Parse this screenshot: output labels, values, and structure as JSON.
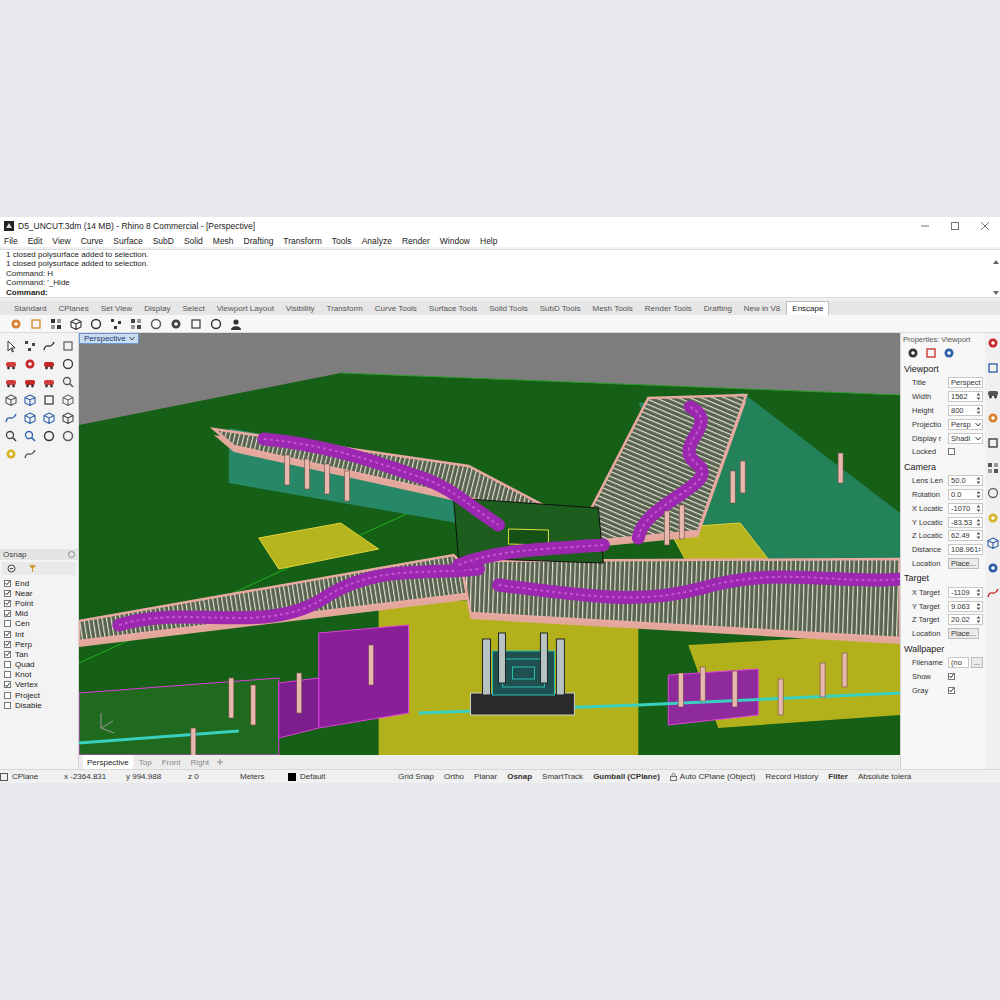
{
  "window": {
    "title": "D5_UNCUT.3dm (14 MB) - Rhino 8 Commercial - [Perspective]"
  },
  "menu": [
    "File",
    "Edit",
    "View",
    "Curve",
    "Surface",
    "SubD",
    "Solid",
    "Mesh",
    "Drafting",
    "Transform",
    "Tools",
    "Analyze",
    "Render",
    "Window",
    "Help"
  ],
  "command": {
    "history": [
      "1 closed polysurface added to selection.",
      "1 closed polysurface added to selection.",
      "Command: H",
      "Command: '_Hide"
    ],
    "prompt": "Command:"
  },
  "toolbar_tabs": [
    {
      "label": "Standard",
      "selected": false
    },
    {
      "label": "CPlanes",
      "selected": false
    },
    {
      "label": "Set View",
      "selected": false
    },
    {
      "label": "Display",
      "selected": false
    },
    {
      "label": "Select",
      "selected": false
    },
    {
      "label": "Viewport Layout",
      "selected": false
    },
    {
      "label": "Visibility",
      "selected": false
    },
    {
      "label": "Transform",
      "selected": false
    },
    {
      "label": "Curve Tools",
      "selected": false
    },
    {
      "label": "Surface Tools",
      "selected": false
    },
    {
      "label": "Solid Tools",
      "selected": false
    },
    {
      "label": "SubD Tools",
      "selected": false
    },
    {
      "label": "Mesh Tools",
      "selected": false
    },
    {
      "label": "Render Tools",
      "selected": false
    },
    {
      "label": "Drafting",
      "selected": false
    },
    {
      "label": "New in V8",
      "selected": false
    },
    {
      "label": "Enscape",
      "selected": true
    }
  ],
  "viewport": {
    "label": "Perspective"
  },
  "viewport_tabs": [
    {
      "label": "Perspective",
      "selected": true
    },
    {
      "label": "Top",
      "selected": false
    },
    {
      "label": "Front",
      "selected": false
    },
    {
      "label": "Right",
      "selected": false
    }
  ],
  "osnap": {
    "title": "Osnap",
    "items": [
      {
        "label": "End",
        "checked": true
      },
      {
        "label": "Near",
        "checked": true
      },
      {
        "label": "Point",
        "checked": true
      },
      {
        "label": "Mid",
        "checked": true
      },
      {
        "label": "Cen",
        "checked": false
      },
      {
        "label": "Int",
        "checked": true
      },
      {
        "label": "Perp",
        "checked": true
      },
      {
        "label": "Tan",
        "checked": true
      },
      {
        "label": "Quad",
        "checked": false
      },
      {
        "label": "Knot",
        "checked": false
      },
      {
        "label": "Vertex",
        "checked": true
      },
      {
        "label": "Project",
        "checked": false
      },
      {
        "label": "Disable",
        "checked": false
      }
    ]
  },
  "properties": {
    "title": "Properties: Viewport",
    "sections": [
      {
        "title": "Viewport",
        "rows": [
          {
            "label": "Title",
            "kind": "text",
            "value": "Perspect"
          },
          {
            "label": "Width",
            "kind": "spin",
            "value": "1562"
          },
          {
            "label": "Height",
            "kind": "spin",
            "value": "800"
          },
          {
            "label": "Projectio",
            "kind": "select",
            "value": "Persp"
          },
          {
            "label": "Display r",
            "kind": "select",
            "value": "Shadi"
          },
          {
            "label": "Locked",
            "kind": "check",
            "checked": false
          }
        ]
      },
      {
        "title": "Camera",
        "rows": [
          {
            "label": "Lens Len",
            "kind": "spin",
            "value": "50.0"
          },
          {
            "label": "Rotation",
            "kind": "spin",
            "value": "0.0"
          },
          {
            "label": "X Locatic",
            "kind": "spin",
            "value": "-1070"
          },
          {
            "label": "Y Locatic",
            "kind": "spin",
            "value": "-83.53"
          },
          {
            "label": "Z Locatic",
            "kind": "spin",
            "value": "62.49"
          },
          {
            "label": "Distance",
            "kind": "spin",
            "value": "108.961"
          },
          {
            "label": "Location",
            "kind": "button",
            "value": "Place..."
          }
        ]
      },
      {
        "title": "Target",
        "rows": [
          {
            "label": "X Target",
            "kind": "spin",
            "value": "-1109"
          },
          {
            "label": "Y Target",
            "kind": "spin",
            "value": "9.063"
          },
          {
            "label": "Z Target",
            "kind": "spin",
            "value": "20.02"
          },
          {
            "label": "Location",
            "kind": "button",
            "value": "Place..."
          }
        ]
      },
      {
        "title": "Wallpaper",
        "rows": [
          {
            "label": "Filename",
            "kind": "file",
            "value": "(no",
            "button": "..."
          },
          {
            "label": "Show",
            "kind": "check",
            "checked": true
          },
          {
            "label": "Gray",
            "kind": "check",
            "checked": true
          }
        ]
      }
    ]
  },
  "status_bar": {
    "cplane": "CPlane",
    "coords": [
      "x -2364.831",
      "y 994.988",
      "z 0"
    ],
    "units": "Meters",
    "layer": {
      "name": "Default",
      "color": "#000000"
    },
    "toggles": [
      {
        "label": "Grid Snap",
        "on": false,
        "kind": "toggle"
      },
      {
        "label": "Ortho",
        "on": false,
        "kind": "toggle"
      },
      {
        "label": "Planar",
        "on": false,
        "kind": "toggle"
      },
      {
        "label": "Osnap",
        "on": true,
        "kind": "toggle"
      },
      {
        "label": "SmartTrack",
        "on": false,
        "kind": "toggle"
      },
      {
        "label": "Gumball (CPlane)",
        "on": true,
        "kind": "toggle"
      },
      {
        "label": "Auto CPlane (Object)",
        "on": false,
        "kind": "lock"
      },
      {
        "label": "Record History",
        "on": false,
        "kind": "toggle"
      },
      {
        "label": "Filter",
        "on": true,
        "kind": "toggle"
      },
      {
        "label": "Absolute tolera",
        "on": false,
        "kind": "toggle"
      }
    ]
  }
}
